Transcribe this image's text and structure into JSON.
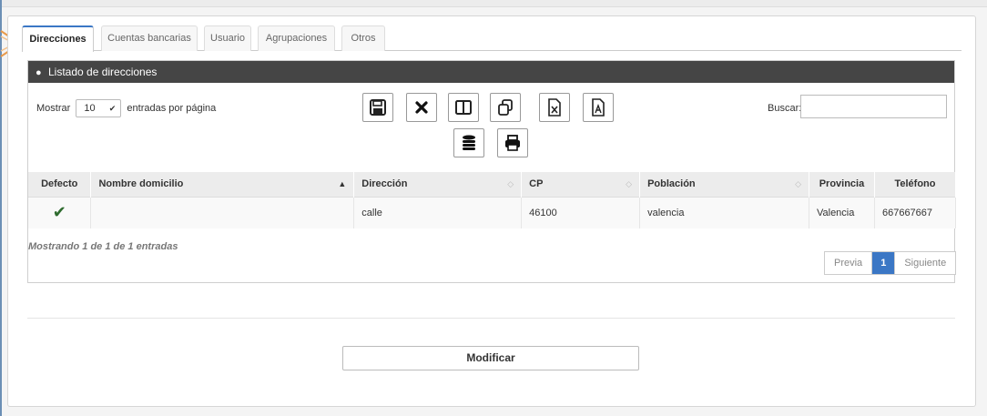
{
  "tabs": [
    {
      "label": "Direcciones",
      "active": true
    },
    {
      "label": "Cuentas bancarias",
      "active": false
    },
    {
      "label": "Usuario",
      "active": false
    },
    {
      "label": "Agrupaciones",
      "active": false
    },
    {
      "label": "Otros",
      "active": false
    }
  ],
  "panel": {
    "title": "Listado de direcciones",
    "icon": "map-marker-icon"
  },
  "length_menu": {
    "prefix": "Mostrar",
    "value": "10",
    "suffix": "entradas por página"
  },
  "toolbar": {
    "buttons": [
      {
        "name": "save-icon"
      },
      {
        "name": "close-icon"
      },
      {
        "name": "columns-icon"
      },
      {
        "name": "copy-icon"
      },
      {
        "name": "excel-icon"
      },
      {
        "name": "pdf-icon"
      },
      {
        "name": "database-icon"
      },
      {
        "name": "print-icon"
      }
    ]
  },
  "search": {
    "label": "Buscar:",
    "value": ""
  },
  "table": {
    "columns": [
      "Defecto",
      "Nombre domicilio",
      "Dirección",
      "CP",
      "Población",
      "Provincia",
      "Teléfono"
    ],
    "rows": [
      {
        "defecto": "✔",
        "nombre": "",
        "direccion": "calle",
        "cp": "46100",
        "poblacion": "valencia",
        "provincia": "Valencia",
        "telefono": "667667667"
      }
    ]
  },
  "info": "Mostrando 1 de 1 de 1 entradas",
  "pagination": {
    "previous": "Previa",
    "current": "1",
    "next": "Siguiente"
  },
  "actions": {
    "modify": "Modificar"
  },
  "colors": {
    "header_bg": "#454545",
    "accent": "#3b77c5",
    "check": "#2e6b2e"
  }
}
